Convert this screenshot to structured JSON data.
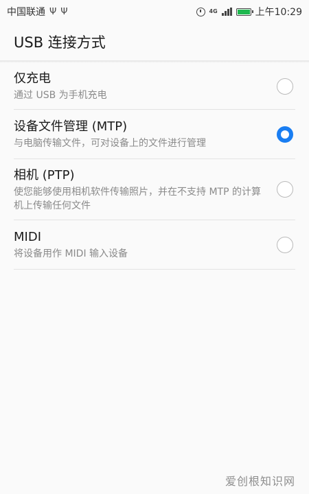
{
  "status_bar": {
    "carrier": "中国联通",
    "left_icons": [
      "usb-icon",
      "usb-icon"
    ],
    "network_badge": "4G",
    "time": "上午10:29",
    "battery_color": "#1fb84f"
  },
  "header": {
    "title": "USB 连接方式"
  },
  "options": [
    {
      "label": "仅充电",
      "description": "通过 USB 为手机充电",
      "selected": false
    },
    {
      "label": "设备文件管理 (MTP)",
      "description": "与电脑传输文件，可对设备上的文件进行管理",
      "selected": true
    },
    {
      "label": "相机 (PTP)",
      "description": "使您能够使用相机软件传输照片，并在不支持 MTP 的计算机上传输任何文件",
      "selected": false
    },
    {
      "label": "MIDI",
      "description": "将设备用作 MIDI 输入设备",
      "selected": false
    }
  ],
  "accent_color": "#1a7ef2",
  "watermark": "爱创根知识网"
}
